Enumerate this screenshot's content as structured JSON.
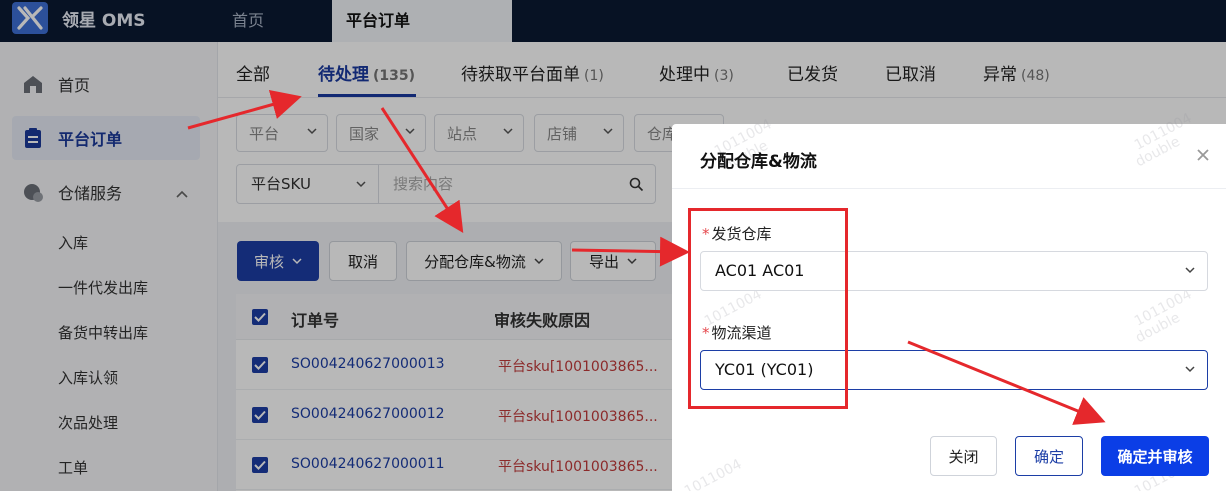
{
  "app": {
    "brand": "领星 OMS"
  },
  "top_tabs": {
    "home": "首页",
    "active": "平台订单"
  },
  "sidebar": {
    "items": [
      {
        "label": "首页",
        "icon": "home-icon"
      },
      {
        "label": "平台订单",
        "icon": "clipboard-icon"
      },
      {
        "label": "仓储服务",
        "icon": "warehouse-icon"
      }
    ],
    "sub_items": [
      "入库",
      "一件代发出库",
      "备货中转出库",
      "入库认领",
      "次品处理",
      "工单"
    ]
  },
  "status_tabs": [
    {
      "label": "全部",
      "count": ""
    },
    {
      "label": "待处理",
      "count": "(135)"
    },
    {
      "label": "待获取平台面单",
      "count": "(1)"
    },
    {
      "label": "处理中",
      "count": "(3)"
    },
    {
      "label": "已发货",
      "count": ""
    },
    {
      "label": "已取消",
      "count": ""
    },
    {
      "label": "异常",
      "count": "(48)"
    }
  ],
  "filters": {
    "platform": "平台",
    "country": "国家",
    "site": "站点",
    "store": "店铺",
    "warehouse": "仓库",
    "sku_type": "平台SKU",
    "search_placeholder": "搜索内容"
  },
  "actions": {
    "audit": "审核",
    "cancel": "取消",
    "assign": "分配仓库&物流",
    "export": "导出"
  },
  "table": {
    "columns": [
      "订单号",
      "审核失败原因"
    ],
    "rows": [
      {
        "order_no": "SO004240627000013",
        "reason": "平台sku[1001003865..."
      },
      {
        "order_no": "SO004240627000012",
        "reason": "平台sku[1001003865..."
      },
      {
        "order_no": "SO004240627000011",
        "reason": "平台sku[1001003865..."
      }
    ]
  },
  "modal": {
    "title": "分配仓库&物流",
    "warehouse_label": "发货仓库",
    "warehouse_value": "AC01 AC01",
    "logistics_label": "物流渠道",
    "logistics_value": "YC01 (YC01)",
    "required_mark": "*",
    "close_label": "关闭",
    "ok_label": "确定",
    "ok_audit_label": "确定并审核"
  },
  "watermark": [
    "1011004",
    "double"
  ],
  "colors": {
    "primary": "#1c3ea6",
    "topbar": "#0b1a33",
    "annotation_red": "#e5282c",
    "error_text": "#c23b3b"
  }
}
